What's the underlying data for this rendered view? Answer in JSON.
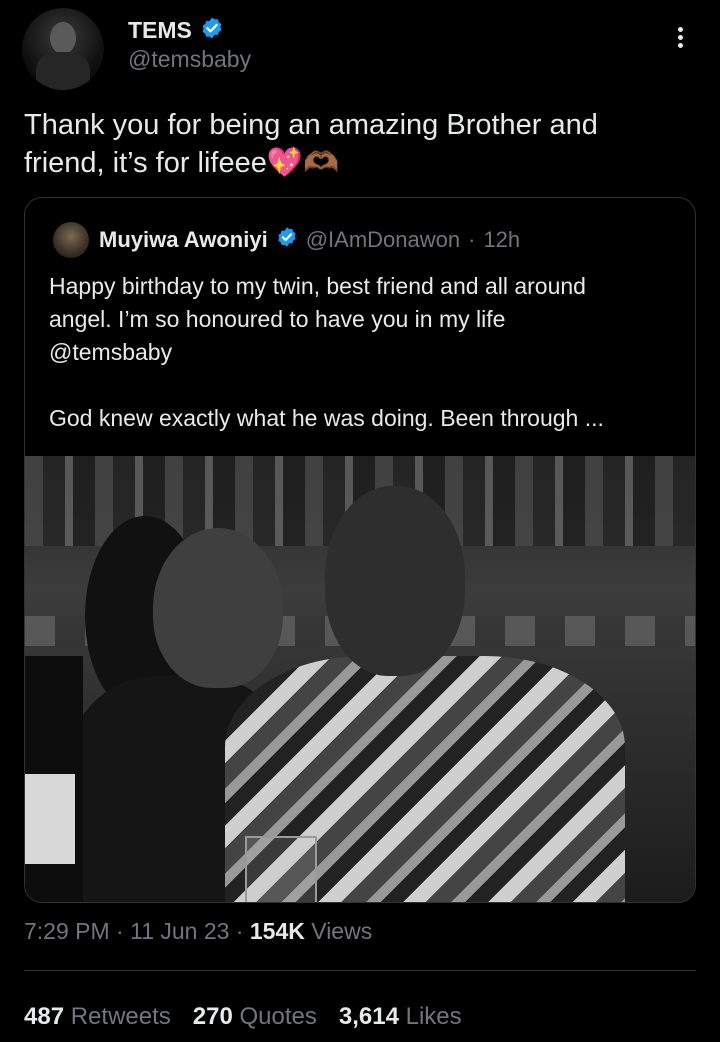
{
  "author": {
    "display_name": "TEMS",
    "handle": "@temsbaby",
    "verified_icon": "verified-badge-icon"
  },
  "tweet": {
    "text_line1": "Thank you for being an amazing Brother and",
    "text_line2": "friend, it’s for lifeee💖🫶🏾"
  },
  "quote": {
    "author_name": "Muyiwa Awoniyi",
    "author_handle": "@IAmDonawon",
    "separator": "·",
    "time_ago": "12h",
    "line1": "Happy birthday to my twin, best friend and all around",
    "line2": "angel. I’m so honoured to have you in my life",
    "line3": "@temsbaby",
    "line4": "God knew exactly what he was doing. Been through ..."
  },
  "meta": {
    "time": "7:29 PM",
    "dot1": "·",
    "date": "11 Jun 23",
    "dot2": "·",
    "views_count": "154K",
    "views_label": "Views"
  },
  "stats": {
    "retweets_count": "487",
    "retweets_label": "Retweets",
    "quotes_count": "270",
    "quotes_label": "Quotes",
    "likes_count": "3,614",
    "likes_label": "Likes"
  },
  "colors": {
    "background": "#000000",
    "text": "#e7e9ea",
    "secondary": "#71767b",
    "verified": "#1d9bf0",
    "border": "#2f3336"
  }
}
